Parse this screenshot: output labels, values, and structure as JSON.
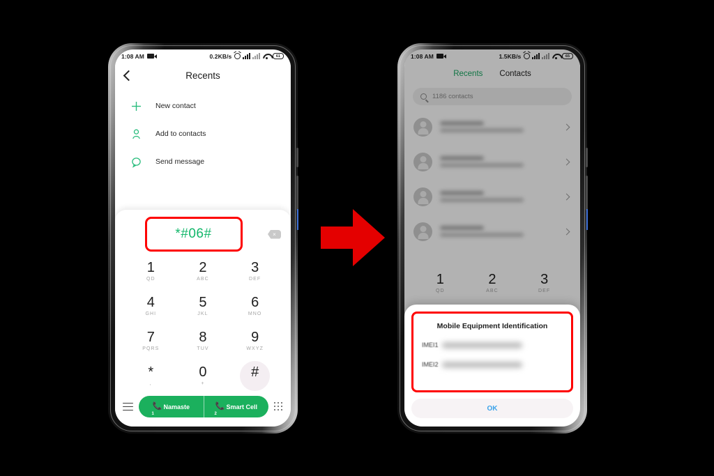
{
  "meta": {
    "background_color": "#000000",
    "highlight_color": "#fe0000",
    "accent_green": "#12b76a"
  },
  "arrow": {
    "name": "red-right-arrow",
    "color": "#e40000"
  },
  "left_phone": {
    "status_bar": {
      "time": "1:08 AM",
      "network_speed": "0.2KB/s",
      "battery": "61",
      "icons": [
        "video-camera-icon",
        "alarm-icon",
        "signal-bars-icon",
        "signal-bars-dim-icon",
        "wifi-icon",
        "battery-icon"
      ]
    },
    "header": {
      "back": "‹",
      "title": "Recents"
    },
    "menu": [
      {
        "icon": "plus-icon",
        "label": "New contact"
      },
      {
        "icon": "person-add-icon",
        "label": "Add to contacts"
      },
      {
        "icon": "message-icon",
        "label": "Send message"
      }
    ],
    "dialer": {
      "value": "*#06#",
      "backspace_label": "⌫",
      "keys": [
        {
          "digit": "1",
          "sub": "QD"
        },
        {
          "digit": "2",
          "sub": "ABC"
        },
        {
          "digit": "3",
          "sub": "DEF"
        },
        {
          "digit": "4",
          "sub": "GHI"
        },
        {
          "digit": "5",
          "sub": "JKL"
        },
        {
          "digit": "6",
          "sub": "MNO"
        },
        {
          "digit": "7",
          "sub": "PQRS"
        },
        {
          "digit": "8",
          "sub": "TUV"
        },
        {
          "digit": "9",
          "sub": "WXYZ"
        },
        {
          "digit": "*",
          "sub": ","
        },
        {
          "digit": "0",
          "sub": "+"
        },
        {
          "digit": "#",
          "sub": ""
        }
      ],
      "call_buttons": [
        {
          "sim": "1",
          "label": "Namaste"
        },
        {
          "sim": "2",
          "label": "Smart Cell"
        }
      ],
      "left_icon": "hamburger-menu-icon",
      "right_icon": "keypad-grid-icon"
    }
  },
  "right_phone": {
    "status_bar": {
      "time": "1:08 AM",
      "network_speed": "1.5KB/s",
      "battery": "65"
    },
    "tabs": [
      {
        "label": "Recents",
        "active": true
      },
      {
        "label": "Contacts",
        "active": false
      }
    ],
    "search": {
      "placeholder": "1186 contacts",
      "icon": "search-icon"
    },
    "contacts_blurred_rows": 4,
    "keys": [
      {
        "digit": "1",
        "sub": "QD"
      },
      {
        "digit": "2",
        "sub": "ABC"
      },
      {
        "digit": "3",
        "sub": "DEF"
      }
    ],
    "dialog": {
      "title": "Mobile Equipment Identification",
      "rows": [
        {
          "label": "IMEI1",
          "value": ""
        },
        {
          "label": "IMEI2",
          "value": ""
        }
      ],
      "ok_label": "OK"
    }
  }
}
